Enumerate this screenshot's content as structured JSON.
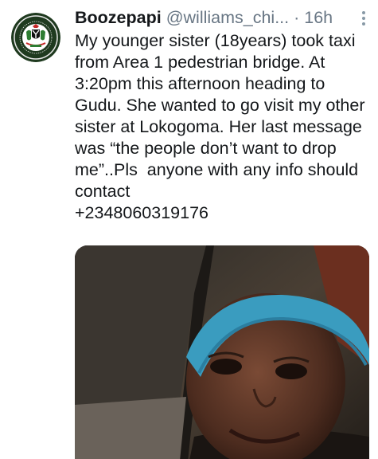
{
  "tweet": {
    "display_name": "Boozepapi",
    "handle": "@williams_chi...",
    "separator": "·",
    "timestamp": "16h",
    "text_paragraph": "My younger sister (18years) took taxi from Area 1 pedestrian bridge. At 3:20pm this afternoon heading to Gudu. She wanted to go visit my other sister at Lokogoma. Her last message was “the people don’t want to drop me”..Pls  anyone with any info should contact",
    "text_phone": "+2348060319176"
  },
  "icons": {
    "avatar": "coat-of-arms-seal",
    "more": "more-vertical-icon"
  },
  "colors": {
    "text_primary": "#14171a",
    "text_secondary": "#687684",
    "avatar_background": "#1f3a1f",
    "headscarf": "#3a9cbf"
  }
}
